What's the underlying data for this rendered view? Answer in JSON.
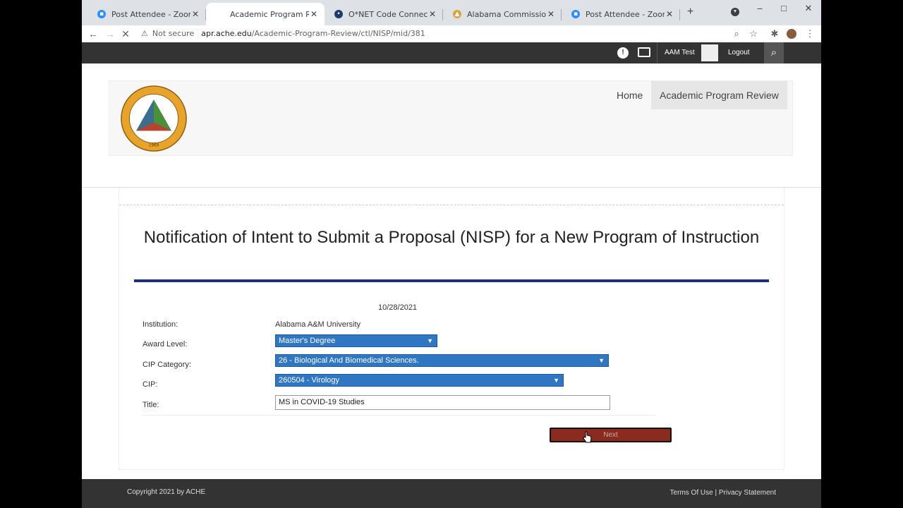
{
  "browser": {
    "tabs": [
      {
        "label": "Post Attendee - Zoom",
        "icon": "zoom-icon",
        "color": "#2d8cff",
        "active": false
      },
      {
        "label": "Academic Program Review",
        "icon": "page-icon",
        "color": "#ffffff",
        "active": true
      },
      {
        "label": "O*NET Code Connector - Job",
        "icon": "onet-icon",
        "color": "#1f3a6e",
        "active": false
      },
      {
        "label": "Alabama Commission on High",
        "icon": "ache-icon",
        "color": "#d8a33a",
        "active": false
      },
      {
        "label": "Post Attendee - Zoom",
        "icon": "zoom-icon",
        "color": "#2d8cff",
        "active": false
      }
    ],
    "security_label": "Not secure",
    "url_host": "apr.ache.edu",
    "url_path": "/Academic-Program-Review/ctl/NISP/mid/381"
  },
  "topnav": {
    "user": "AAM Test",
    "logout": "Logout"
  },
  "header": {
    "logo_text": "ALABAMA COMMISSION ON HIGHER EDUCATION",
    "logo_year": "1969",
    "logo_center": "COORDINATION",
    "menu": {
      "home": "Home",
      "apr": "Academic Program Review"
    }
  },
  "page": {
    "title": "Notification of Intent to Submit a Proposal (NISP) for a New Program of Instruction",
    "date": "10/28/2021"
  },
  "form": {
    "institution_label": "Institution:",
    "institution_value": "Alabama A&M University",
    "award_label": "Award Level:",
    "award_value": "Master's Degree",
    "cip_category_label": "CIP Category:",
    "cip_category_value": "26 - Biological And Biomedical Sciences.",
    "cip_label": "CIP:",
    "cip_value": "260504 - Virology",
    "title_label": "Title:",
    "title_value": "MS in COVID-19 Studies",
    "next_label": "Next"
  },
  "footer": {
    "copyright": "Copyright 2021 by ACHE",
    "terms": "Terms Of Use",
    "separator": "|",
    "privacy": "Privacy Statement"
  },
  "colors": {
    "accent_blue": "#2f77c3",
    "rule_navy": "#1f2f72",
    "button_red": "#8b2b1f",
    "bar_dark": "#333333"
  }
}
